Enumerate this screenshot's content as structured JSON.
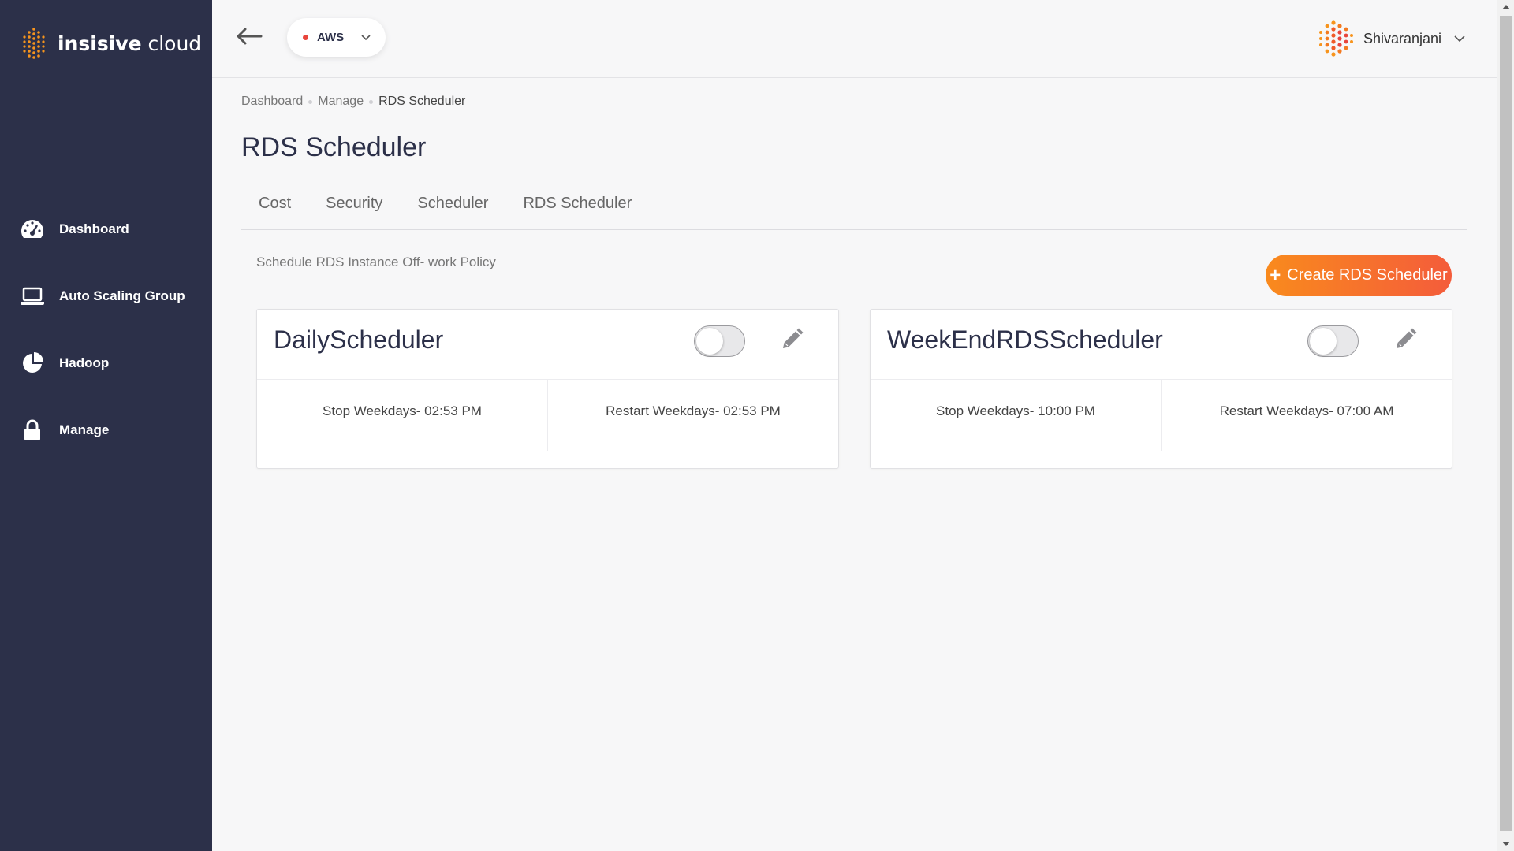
{
  "app": {
    "logo_bold": "insisive",
    "logo_light": " cloud"
  },
  "sidebar": {
    "items": [
      {
        "label": "Dashboard",
        "icon": "dashboard-gauge-icon"
      },
      {
        "label": "Auto Scaling Group",
        "icon": "laptop-icon"
      },
      {
        "label": "Hadoop",
        "icon": "pie-chart-icon"
      },
      {
        "label": "Manage",
        "icon": "lock-icon"
      }
    ]
  },
  "header": {
    "cloud_provider": "AWS",
    "cloud_status_color": "#e8453c",
    "user_name": "Shivaranjani"
  },
  "breadcrumb": {
    "items": [
      "Dashboard",
      "Manage",
      "RDS Scheduler"
    ]
  },
  "page": {
    "title": "RDS Scheduler",
    "subtitle": "Schedule RDS Instance Off- work Policy",
    "create_button": "Create RDS Scheduler"
  },
  "tabs": [
    "Cost",
    "Security",
    "Scheduler",
    "RDS Scheduler"
  ],
  "schedulers": [
    {
      "name": "DailyScheduler",
      "enabled": false,
      "stop": "Stop Weekdays- 02:53 PM",
      "restart": "Restart Weekdays- 02:53 PM"
    },
    {
      "name": "WeekEndRDSScheduler",
      "enabled": false,
      "stop": "Stop Weekdays- 10:00 PM",
      "restart": "Restart Weekdays- 07:00 AM"
    }
  ],
  "colors": {
    "sidebar_bg": "#2c3049",
    "accent_start": "#f98a1d",
    "accent_end": "#f45c3b"
  }
}
